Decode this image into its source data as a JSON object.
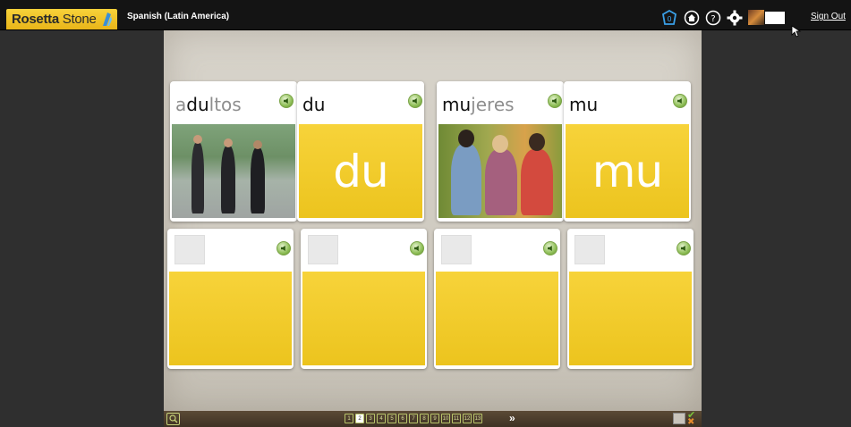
{
  "app": {
    "logo_text_bold": "Rosetta",
    "logo_text_rest": " Stone",
    "course": "Spanish (Latin America)",
    "sign_out": "Sign Out",
    "brand_color": "#f2c830"
  },
  "toolbar_icons": [
    "home-shield-icon",
    "home-icon",
    "help-icon",
    "gear-icon",
    "avatar"
  ],
  "cards_top": [
    {
      "word_bold": "a",
      "word_mid": "du",
      "word_tail": "ltos",
      "face": "photo",
      "photo": "adults"
    },
    {
      "word": "du",
      "face_text": "du"
    },
    {
      "word_bold": "mu",
      "word_mid": "",
      "word_tail": "jeres",
      "face": "photo",
      "photo": "women"
    },
    {
      "word": "mu",
      "face_text": "mu"
    }
  ],
  "pages": [
    "1",
    "2",
    "3",
    "4",
    "5",
    "6",
    "7",
    "8",
    "9",
    "10",
    "11",
    "12",
    "13"
  ],
  "current_page": "2",
  "next_label": "»",
  "status": {
    "check": "✔",
    "x": "✖"
  }
}
